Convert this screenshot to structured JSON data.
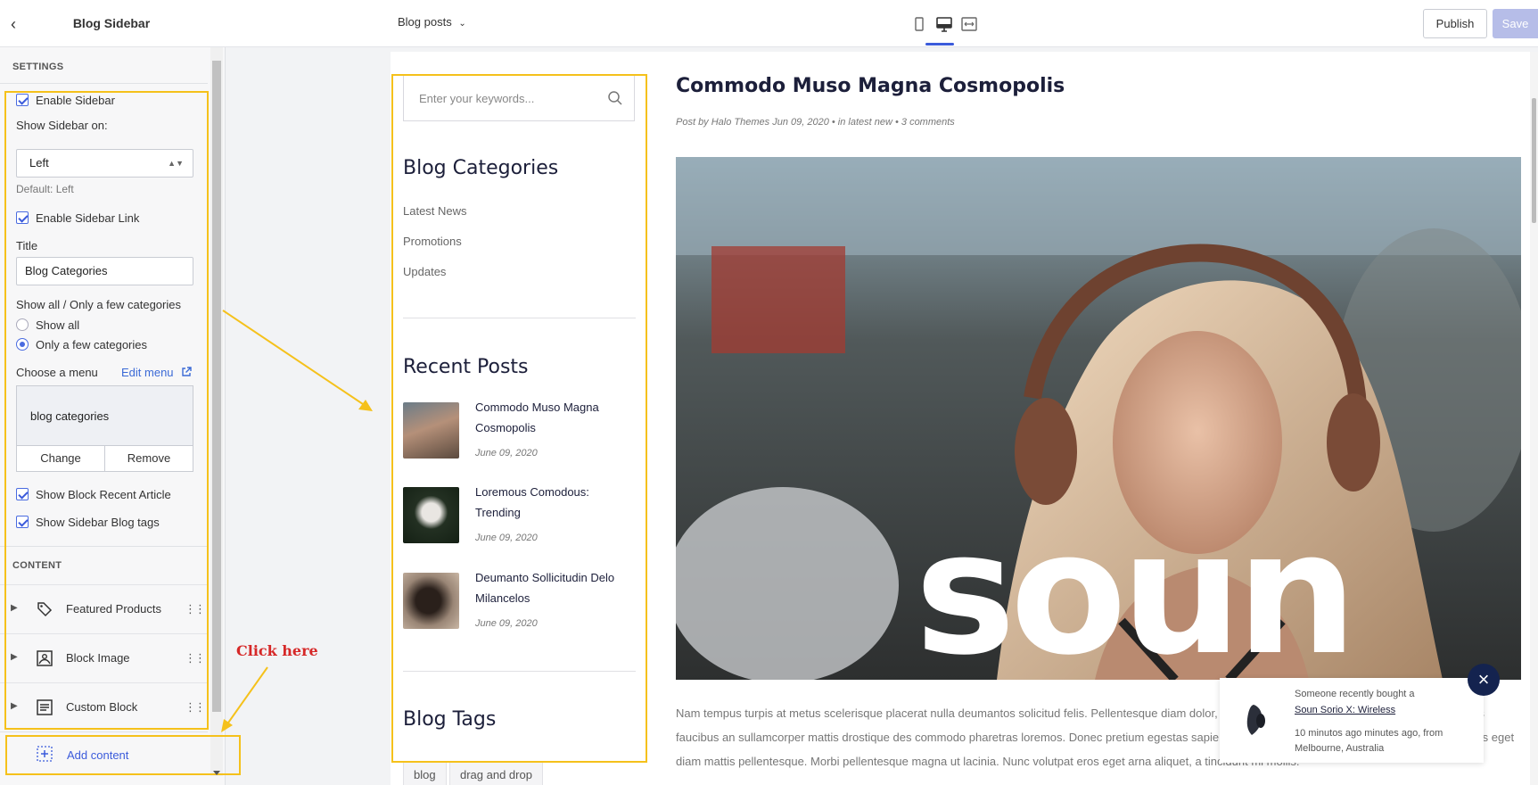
{
  "panel": {
    "title": "Blog Sidebar",
    "settings_label": "SETTINGS",
    "enable_sidebar": "Enable Sidebar",
    "show_sidebar_on_label": "Show Sidebar on:",
    "show_sidebar_on_value": "Left",
    "default_hint": "Default: Left",
    "enable_sidebar_link": "Enable Sidebar Link",
    "title_label": "Title",
    "title_value": "Blog Categories",
    "show_all_label": "Show all / Only a few categories",
    "radio_show_all": "Show all",
    "radio_few": "Only a few categories",
    "choose_menu_label": "Choose a menu",
    "edit_menu_link": "Edit menu",
    "menu_value": "blog categories",
    "change_button": "Change",
    "remove_button": "Remove",
    "show_recent_article": "Show Block Recent Article",
    "show_blog_tags": "Show Sidebar Blog tags",
    "content_label": "CONTENT",
    "blocks": [
      "Featured Products",
      "Block Image",
      "Custom Block"
    ],
    "add_content": "Add content"
  },
  "topbar": {
    "page_select": "Blog posts",
    "publish": "Publish",
    "save": "Save"
  },
  "preview": {
    "search_placeholder": "Enter your keywords...",
    "categories_heading": "Blog Categories",
    "categories": [
      "Latest News",
      "Promotions",
      "Updates"
    ],
    "recent_heading": "Recent Posts",
    "recent_posts": [
      {
        "title": "Commodo Muso Magna Cosmopolis",
        "date": "June 09, 2020"
      },
      {
        "title": "Loremous Comodous: Trending",
        "date": "June 09, 2020"
      },
      {
        "title": "Deumanto Sollicitudin Delo Milancelos",
        "date": "June 09, 2020"
      }
    ],
    "tags_heading": "Blog Tags",
    "tags": [
      "blog",
      "drag and drop"
    ],
    "post_title": "Commodo Muso Magna Cosmopolis",
    "post_meta": "Post by Halo Themes Jun 09, 2020   •  in latest new   •  3 comments",
    "image_text": "soun",
    "post_body": "Nam tempus turpis at metus scelerisque placerat nulla deumantos solicitud felis. Pellentesque diam dolor, elementum etos lobortis des mollis ut risus. Sedcus faucibus an sullamcorper mattis drostique des commodo pharetras loremos. Donec pretium egestas sapien et mollis. Pellentesque diam dolor cosmopolis etos eget diam mattis pellentesque. Morbi pellentesque magna ut lacinia. Nunc volutpat eros eget arna aliquet, a tincidunt mi mollis.",
    "toast": {
      "line1": "Someone recently bought a",
      "product": "Soun Sorio X: Wireless",
      "time": "10 minutos ago minutes ago, from",
      "place": "Melbourne, Australia"
    }
  },
  "annotation": {
    "click_here": "Click here"
  },
  "colors": {
    "accent": "#3b5bdb",
    "highlight": "#f5c11b",
    "annotation_text": "#d62828",
    "heading": "#1c1f3a"
  }
}
